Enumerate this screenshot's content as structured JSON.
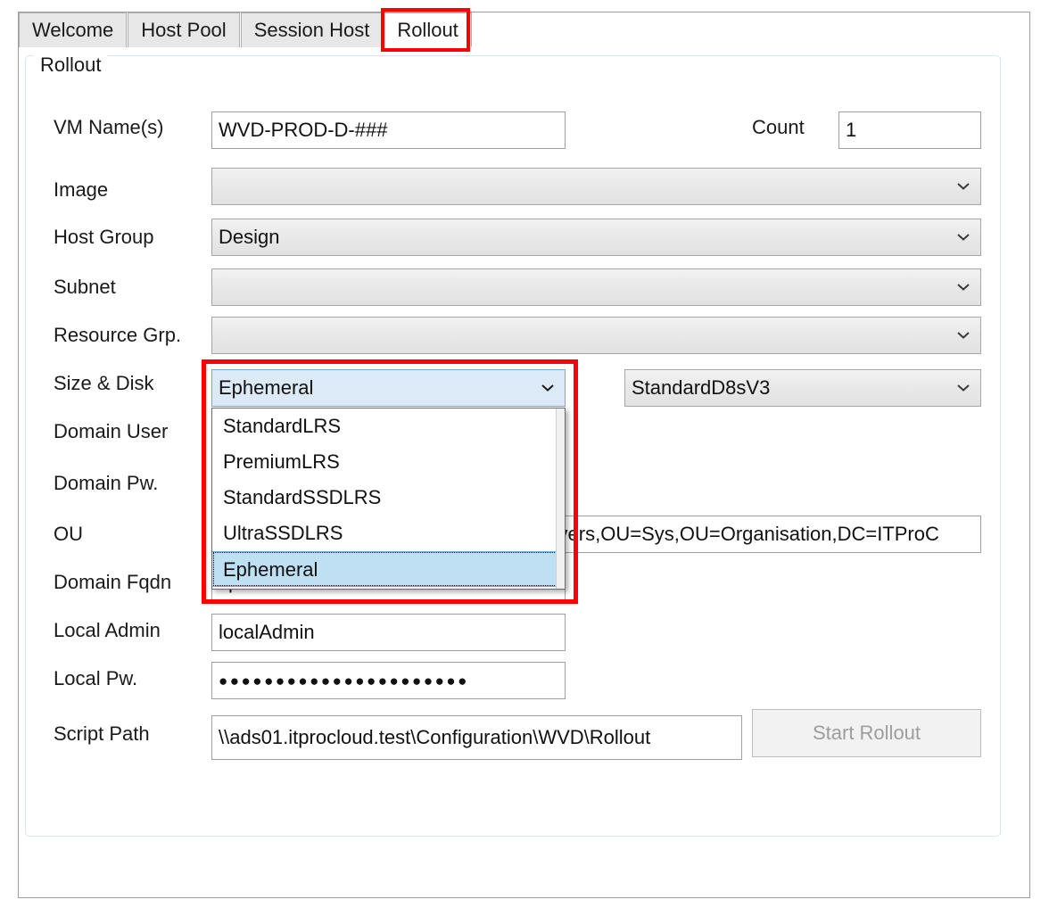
{
  "window": {
    "tabs": [
      {
        "label": "Welcome",
        "active": false
      },
      {
        "label": "Host Pool",
        "active": false
      },
      {
        "label": "Session Host",
        "active": false
      },
      {
        "label": "Rollout",
        "active": true
      }
    ]
  },
  "group": {
    "title": "Rollout"
  },
  "form": {
    "vm_names": {
      "label": "VM Name(s)",
      "value": "WVD-PROD-D-###"
    },
    "count": {
      "label": "Count",
      "value": "1"
    },
    "image": {
      "label": "Image",
      "value": ""
    },
    "host_group": {
      "label": "Host Group",
      "value": "Design"
    },
    "subnet": {
      "label": "Subnet",
      "value": ""
    },
    "resource_group": {
      "label": "Resource Grp.",
      "value": ""
    },
    "size_disk": {
      "label": "Size & Disk",
      "disk_value": "Ephemeral",
      "size_value": "StandardD8sV3",
      "options": [
        "StandardLRS",
        "PremiumLRS",
        "StandardSSDLRS",
        "UltraSSDLRS",
        "Ephemeral"
      ],
      "selected_option": "Ephemeral"
    },
    "domain_user": {
      "label": "Domain User",
      "value": ""
    },
    "domain_pw": {
      "label": "Domain Pw.",
      "value": ""
    },
    "ou": {
      "label": "OU",
      "value": "ervers,OU=Sys,OU=Organisation,DC=ITProC"
    },
    "domain_fqdn": {
      "label": "Domain Fqdn",
      "value": "itprocloud.test"
    },
    "local_admin": {
      "label": "Local Admin",
      "value": "localAdmin"
    },
    "local_pw": {
      "label": "Local Pw.",
      "value": "●●●●●●●●●●●●●●●●●●●●●●"
    },
    "script_path": {
      "label": "Script Path",
      "value": "\\\\ads01.itprocloud.test\\Configuration\\WVD\\Rollout"
    }
  },
  "actions": {
    "start_rollout": "Start Rollout"
  },
  "colors": {
    "annotation": "#ff0000",
    "selection": "#bfe0f2",
    "combo_open": "#dceaf7"
  }
}
